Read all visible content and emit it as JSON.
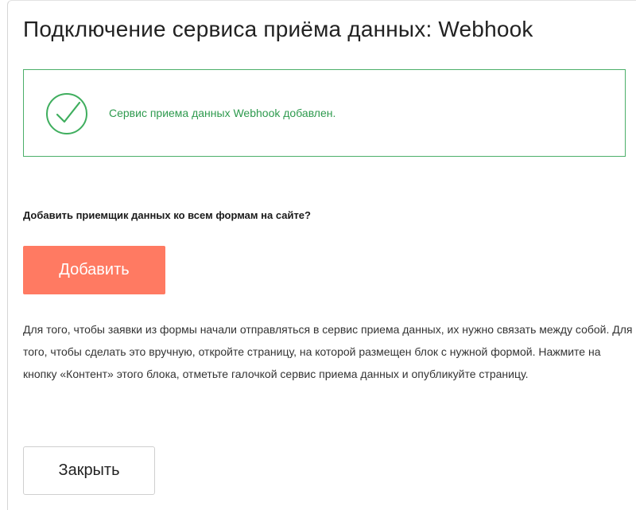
{
  "dialog": {
    "title": "Подключение сервиса приёма данных: Webhook"
  },
  "alert": {
    "icon": "check-circle-icon",
    "message": "Сервис приема данных Webhook добавлен.",
    "color": "#2e9a4e"
  },
  "prompt": {
    "question": "Добавить приемщик данных ко всем формам на сайте?",
    "add_label": "Добавить",
    "add_color": "#ff7a62"
  },
  "description": "Для того, чтобы заявки из формы начали отправляться в сервис приема данных, их нужно связать между собой. Для того, чтобы сделать это вручную, откройте страницу, на которой размещен блок с нужной формой. Нажмите на кнопку «Контент» этого блока, отметьте галочкой сервис приема данных и опубликуйте страницу.",
  "footer": {
    "close_label": "Закрыть"
  }
}
